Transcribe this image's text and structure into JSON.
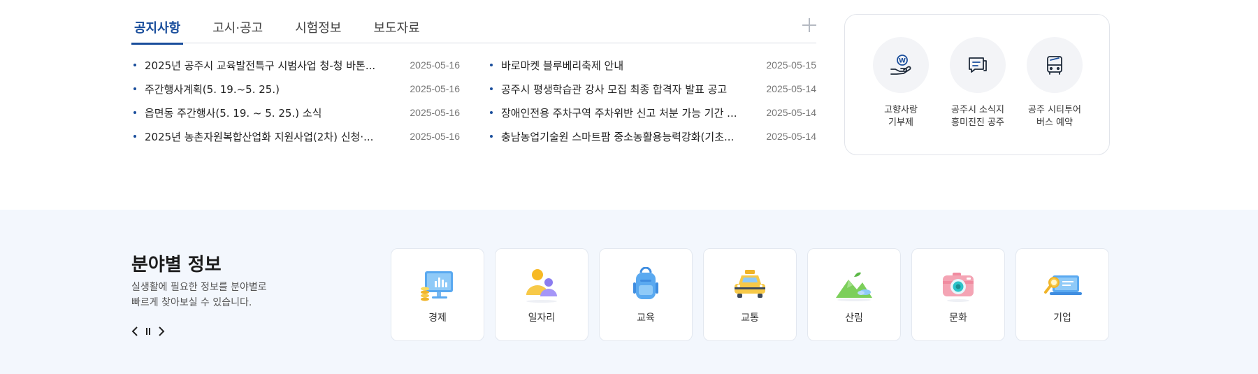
{
  "tabs": [
    "공지사항",
    "고시·공고",
    "시험정보",
    "보도자료"
  ],
  "notices_left": [
    {
      "title": "2025년 공주시 교육발전특구 시범사업 청-청 바톤...",
      "date": "2025-05-16"
    },
    {
      "title": "주간행사계획(5. 19.~5. 25.)",
      "date": "2025-05-16"
    },
    {
      "title": "읍면동 주간행사(5. 19. ~ 5. 25.) 소식",
      "date": "2025-05-16"
    },
    {
      "title": "2025년 농촌자원복합산업화 지원사업(2차) 신청·...",
      "date": "2025-05-16"
    }
  ],
  "notices_right": [
    {
      "title": "바로마켓 블루베리축제 안내",
      "date": "2025-05-15"
    },
    {
      "title": "공주시 평생학습관 강사 모집 최종 합격자 발표 공고",
      "date": "2025-05-14"
    },
    {
      "title": "장애인전용 주차구역 주차위반 신고 처분 가능 기간 ...",
      "date": "2025-05-14"
    },
    {
      "title": "충남농업기술원 스마트팜 중소농활용능력강화(기초...",
      "date": "2025-05-14"
    }
  ],
  "quick_links": [
    {
      "line1": "고향사랑",
      "line2": "기부제",
      "icon": "hand-coin-icon"
    },
    {
      "line1": "공주시 소식지",
      "line2": "흥미진진 공주",
      "icon": "newsletter-icon"
    },
    {
      "line1": "공주 시티투어",
      "line2": "버스 예약",
      "icon": "bus-icon"
    }
  ],
  "field_info": {
    "title": "분야별 정보",
    "desc_line1": "실생활에 필요한 정보를 분야별로",
    "desc_line2": "빠르게 찾아보실 수 있습니다.",
    "cards": [
      {
        "label": "경제",
        "icon": "economy-monitor-icon"
      },
      {
        "label": "일자리",
        "icon": "jobs-people-icon"
      },
      {
        "label": "교육",
        "icon": "education-backpack-icon"
      },
      {
        "label": "교통",
        "icon": "traffic-taxi-icon"
      },
      {
        "label": "산림",
        "icon": "forest-mountain-icon"
      },
      {
        "label": "문화",
        "icon": "culture-camera-icon"
      },
      {
        "label": "기업",
        "icon": "business-laptop-icon"
      }
    ]
  },
  "colors": {
    "accent": "#1a4e9c",
    "section_bg": "#f3f7fd"
  }
}
